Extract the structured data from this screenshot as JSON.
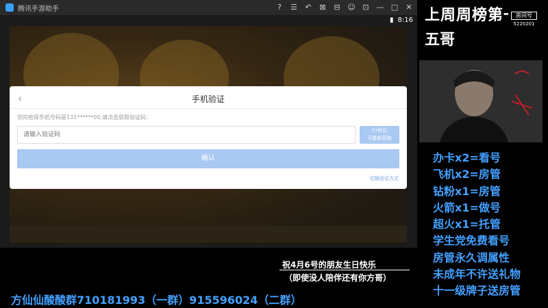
{
  "emulator": {
    "title": "腾讯手游助手",
    "controls": [
      "?",
      "☰",
      "↶",
      "⊠",
      "⊟",
      "☺",
      "⊡",
      "—",
      "□",
      "✕"
    ],
    "android_time": "8:16"
  },
  "dialog": {
    "back_icon": "chevron-left-icon",
    "title": "手机验证",
    "hint": "您的密保手机号码是131******00,请点击获取验证码：",
    "input_placeholder": "请输入验证码",
    "resend_countdown": "57秒后",
    "resend_label": "可重新获取",
    "confirm_label": "确认",
    "switch_label": "切换验证方式"
  },
  "sidebar": {
    "rank_title": "上周周榜第一",
    "rank_name": "五哥",
    "room_label": "房间号",
    "room_number": "5220201",
    "perks": [
      "办卡x2=看号",
      "飞机x2=房管",
      "钻粉x1=房管",
      "火箭x1=做号",
      "超火x1=托管",
      "学生党免费看号",
      "房管永久调属性",
      "未成年不许送礼物",
      "十一级牌子送房管"
    ]
  },
  "overlay": {
    "birthday_line1": "祝4月6号的朋友生日快乐",
    "birthday_line2": "（即使没人陪伴还有你方哥）",
    "fan_group": "方仙仙酸酸群710181993（一群）915596024（二群）"
  },
  "colors": {
    "accent_blue": "#43a0ff",
    "button_disabled": "#a9c8f2"
  }
}
